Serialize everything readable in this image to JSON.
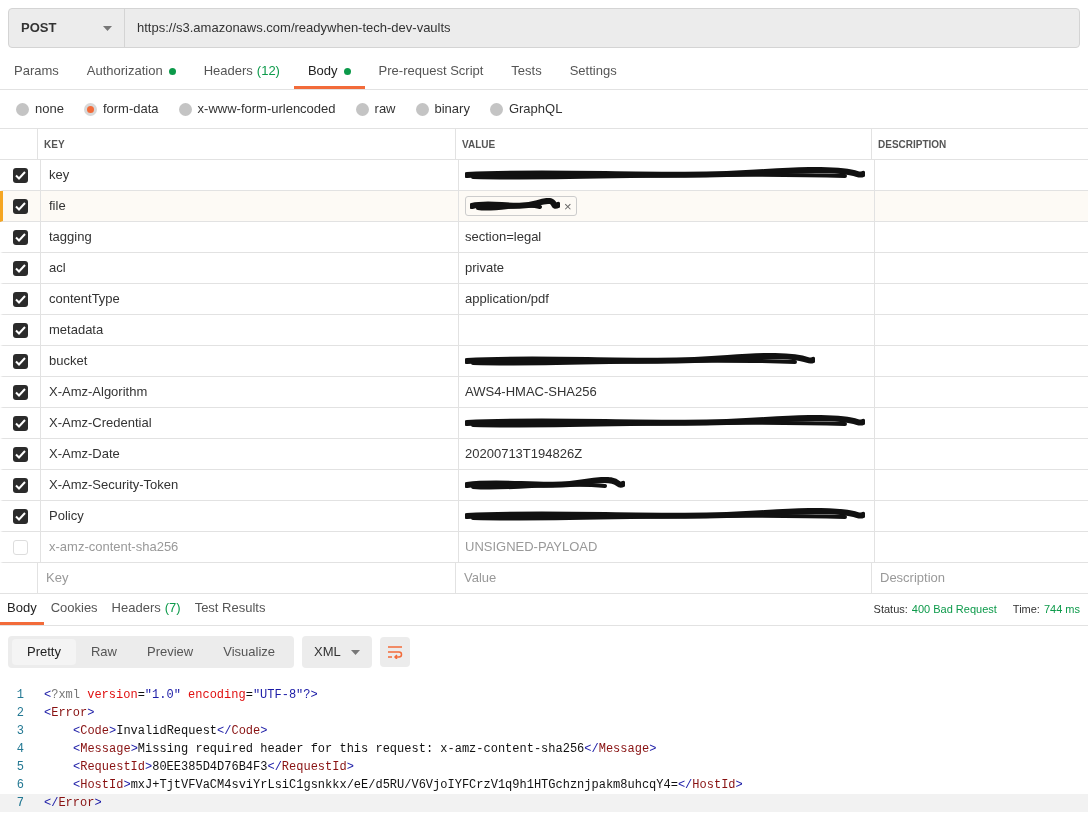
{
  "request": {
    "method": "POST",
    "url": "https://s3.amazonaws.com/readywhen-tech-dev-vaults"
  },
  "tabs": [
    {
      "label": "Params",
      "selected": false,
      "dot": false
    },
    {
      "label": "Authorization",
      "selected": false,
      "dot": true
    },
    {
      "label": "Headers",
      "count": "(12)",
      "selected": false,
      "dot": false
    },
    {
      "label": "Body",
      "selected": true,
      "dot": true
    },
    {
      "label": "Pre-request Script",
      "selected": false,
      "dot": false
    },
    {
      "label": "Tests",
      "selected": false,
      "dot": false
    },
    {
      "label": "Settings",
      "selected": false,
      "dot": false
    }
  ],
  "body_types": [
    {
      "label": "none",
      "selected": false
    },
    {
      "label": "form-data",
      "selected": true
    },
    {
      "label": "x-www-form-urlencoded",
      "selected": false
    },
    {
      "label": "raw",
      "selected": false
    },
    {
      "label": "binary",
      "selected": false
    },
    {
      "label": "GraphQL",
      "selected": false
    }
  ],
  "table": {
    "columns": [
      "KEY",
      "VALUE",
      "DESCRIPTION"
    ],
    "rows": [
      {
        "checked": true,
        "key": "key",
        "kind": "redacted",
        "highlighted": false
      },
      {
        "checked": true,
        "key": "file",
        "kind": "file",
        "remove_icon": "×",
        "highlighted": true
      },
      {
        "checked": true,
        "key": "tagging",
        "kind": "text",
        "value": "section=legal",
        "highlighted": false
      },
      {
        "checked": true,
        "key": "acl",
        "kind": "text",
        "value": "private",
        "highlighted": false
      },
      {
        "checked": true,
        "key": "contentType",
        "kind": "text",
        "value": "application/pdf",
        "highlighted": false
      },
      {
        "checked": true,
        "key": "metadata",
        "kind": "empty",
        "highlighted": false
      },
      {
        "checked": true,
        "key": "bucket",
        "kind": "redacted",
        "highlighted": false
      },
      {
        "checked": true,
        "key": "X-Amz-Algorithm",
        "kind": "text",
        "value": "AWS4-HMAC-SHA256",
        "highlighted": false
      },
      {
        "checked": true,
        "key": "X-Amz-Credential",
        "kind": "redacted",
        "highlighted": false
      },
      {
        "checked": true,
        "key": "X-Amz-Date",
        "kind": "text",
        "value": "20200713T194826Z",
        "highlighted": false
      },
      {
        "checked": true,
        "key": "X-Amz-Security-Token",
        "kind": "redacted",
        "highlighted": false
      },
      {
        "checked": true,
        "key": "Policy",
        "kind": "redacted",
        "highlighted": false
      },
      {
        "checked": false,
        "key": "x-amz-content-sha256",
        "kind": "text",
        "value": "UNSIGNED-PAYLOAD",
        "highlighted": false
      }
    ],
    "new_row": {
      "key_placeholder": "Key",
      "value_placeholder": "Value",
      "description_placeholder": "Description"
    }
  },
  "response": {
    "tabs": [
      {
        "label": "Body",
        "selected": true
      },
      {
        "label": "Cookies",
        "selected": false
      },
      {
        "label": "Headers",
        "count": "(7)",
        "selected": false
      },
      {
        "label": "Test Results",
        "selected": false
      }
    ],
    "status_label": "Status:",
    "status": "400 Bad Request",
    "time_label": "Time:",
    "time": "744 ms",
    "views": [
      {
        "label": "Pretty",
        "selected": true
      },
      {
        "label": "Raw",
        "selected": false
      },
      {
        "label": "Preview",
        "selected": false
      },
      {
        "label": "Visualize",
        "selected": false
      }
    ],
    "format": "XML",
    "code": [
      {
        "number": "1",
        "current": false,
        "indented": false,
        "tokens": [
          {
            "kind": "bracket",
            "t": "<"
          },
          {
            "kind": "decl",
            "t": "?xml "
          },
          {
            "kind": "attr",
            "t": "version"
          },
          {
            "kind": "text",
            "t": "="
          },
          {
            "kind": "string",
            "t": "\"1.0\" "
          },
          {
            "kind": "attr",
            "t": "encoding"
          },
          {
            "kind": "text",
            "t": "="
          },
          {
            "kind": "string",
            "t": "\"UTF-8\""
          },
          {
            "kind": "bracket",
            "t": "?>"
          }
        ]
      },
      {
        "number": "2",
        "current": false,
        "indented": false,
        "tokens": [
          {
            "kind": "bracket",
            "t": "<"
          },
          {
            "kind": "tag",
            "t": "Error"
          },
          {
            "kind": "bracket",
            "t": ">"
          }
        ]
      },
      {
        "number": "3",
        "current": false,
        "indented": true,
        "tokens": [
          {
            "kind": "bracket",
            "t": "<"
          },
          {
            "kind": "tag",
            "t": "Code"
          },
          {
            "kind": "bracket",
            "t": ">"
          },
          {
            "kind": "text",
            "t": "InvalidRequest"
          },
          {
            "kind": "bracket",
            "t": "</"
          },
          {
            "kind": "tag",
            "t": "Code"
          },
          {
            "kind": "bracket",
            "t": ">"
          }
        ]
      },
      {
        "number": "4",
        "current": false,
        "indented": true,
        "tokens": [
          {
            "kind": "bracket",
            "t": "<"
          },
          {
            "kind": "tag",
            "t": "Message"
          },
          {
            "kind": "bracket",
            "t": ">"
          },
          {
            "kind": "text",
            "t": "Missing required header for this request: x-amz-content-sha256"
          },
          {
            "kind": "bracket",
            "t": "</"
          },
          {
            "kind": "tag",
            "t": "Message"
          },
          {
            "kind": "bracket",
            "t": ">"
          }
        ]
      },
      {
        "number": "5",
        "current": false,
        "indented": true,
        "tokens": [
          {
            "kind": "bracket",
            "t": "<"
          },
          {
            "kind": "tag",
            "t": "RequestId"
          },
          {
            "kind": "bracket",
            "t": ">"
          },
          {
            "kind": "text",
            "t": "80EE385D4D76B4F3"
          },
          {
            "kind": "bracket",
            "t": "</"
          },
          {
            "kind": "tag",
            "t": "RequestId"
          },
          {
            "kind": "bracket",
            "t": ">"
          }
        ]
      },
      {
        "number": "6",
        "current": false,
        "indented": true,
        "tokens": [
          {
            "kind": "bracket",
            "t": "<"
          },
          {
            "kind": "tag",
            "t": "HostId"
          },
          {
            "kind": "bracket",
            "t": ">"
          },
          {
            "kind": "text",
            "t": "mxJ+TjtVFVaCM4sviYrLsiC1gsnkkx/eE/d5RU/V6VjoIYFCrzV1q9h1HTGchznjpakm8uhcqY4="
          },
          {
            "kind": "bracket",
            "t": "</"
          },
          {
            "kind": "tag",
            "t": "HostId"
          },
          {
            "kind": "bracket",
            "t": ">"
          }
        ]
      },
      {
        "number": "7",
        "current": true,
        "indented": false,
        "tokens": [
          {
            "kind": "bracket",
            "t": "</"
          },
          {
            "kind": "tag",
            "t": "Error"
          },
          {
            "kind": "bracket",
            "t": ">"
          }
        ]
      }
    ]
  }
}
